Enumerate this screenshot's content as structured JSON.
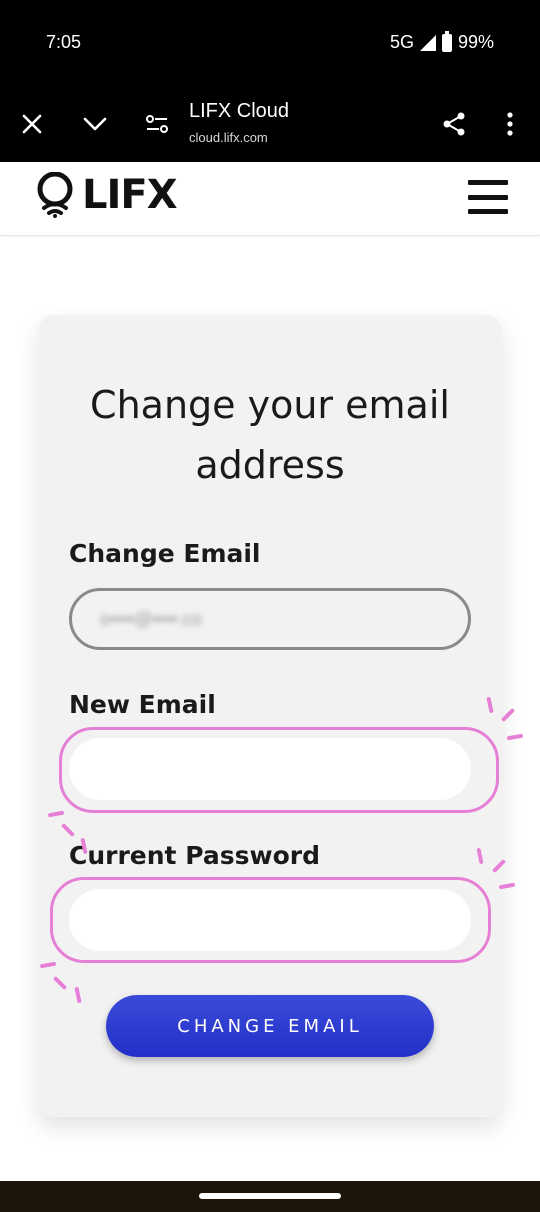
{
  "status": {
    "time": "7:05",
    "network": "5G",
    "battery": "99%"
  },
  "browser": {
    "title": "LIFX Cloud",
    "url": "cloud.lifx.com"
  },
  "site": {
    "logo": "LIFX"
  },
  "card": {
    "title_line1": "Change your email",
    "title_line2": "address",
    "change_email_label": "Change Email",
    "current_email_value": "s••••@••••.co",
    "new_email_label": "New Email",
    "new_email_value": "",
    "password_label": "Current Password",
    "password_value": "",
    "button_label": "CHANGE EMAIL"
  },
  "colors": {
    "accent": "#2a38cf",
    "highlight": "#e67fd6",
    "card_bg": "#f2f2f2"
  }
}
